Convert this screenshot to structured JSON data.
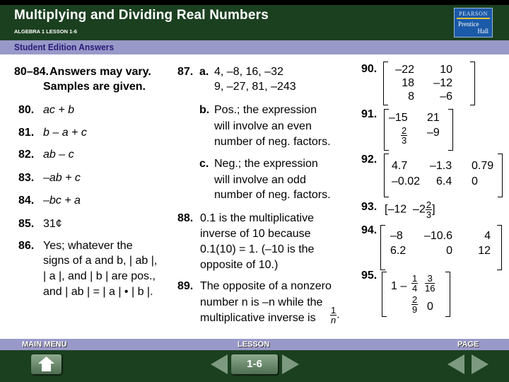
{
  "header": {
    "title": "Multiplying and Dividing Real Numbers",
    "subtitle": "ALGEBRA 1  LESSON 1-6",
    "logo_top": "PEARSON",
    "logo_line1": "Prentice",
    "logo_line2": "Hall"
  },
  "band": {
    "label": "Student Edition Answers"
  },
  "col1": {
    "intro_num": "80–84.",
    "intro_l1": "Answers may vary.",
    "intro_l2": "Samples are given.",
    "items": [
      {
        "num": "80.",
        "text": "ac + b"
      },
      {
        "num": "81.",
        "text": "b – a + c"
      },
      {
        "num": "82.",
        "text": "ab – c"
      },
      {
        "num": "83.",
        "text": "–ab + c"
      },
      {
        "num": "84.",
        "text": "–bc + a"
      },
      {
        "num": "85.",
        "text": "31¢"
      }
    ],
    "q86": {
      "num": "86.",
      "lines": [
        "Yes; whatever the",
        "signs of a and b, | ab |,",
        "| a |, and | b | are pos.,",
        "and | ab | = | a | • | b |."
      ]
    }
  },
  "col2": {
    "q87": {
      "num": "87.",
      "a_label": "a.",
      "a_lines": [
        "4, –8, 16, –32",
        "9, –27, 81, –243"
      ],
      "b_label": "b.",
      "b_lines": [
        "Pos.; the expression",
        " will involve an even",
        "number of neg. factors."
      ],
      "c_label": "c.",
      "c_lines": [
        "Neg.; the expression",
        "will involve an odd",
        "number of neg. factors."
      ]
    },
    "q88": {
      "num": "88.",
      "lines": [
        "0.1 is the multiplicative",
        "inverse of 10 because",
        "0.1(10) = 1. (–10 is the",
        "opposite of 10.)"
      ]
    },
    "q89": {
      "num": "89.",
      "lines": [
        "The opposite of a nonzero",
        "number n is –n while the",
        "multiplicative inverse is"
      ],
      "frac_num": "1",
      "frac_den": "n",
      "end": "."
    }
  },
  "col3": {
    "q90": {
      "num": "90.",
      "rows": [
        [
          "–22",
          "10"
        ],
        [
          "18",
          "–12"
        ],
        [
          "8",
          "–6"
        ]
      ]
    },
    "q91": {
      "num": "91.",
      "r1": [
        "–15",
        "21"
      ],
      "r2_frac_num": "2",
      "r2_frac_den": "3",
      "r2_c2": "–9"
    },
    "q92": {
      "num": "92.",
      "rows": [
        [
          "4.7",
          "–1.3",
          "0.79"
        ],
        [
          "–0.02",
          "6.4",
          "0"
        ]
      ]
    },
    "q93": {
      "num": "93.",
      "open": "[",
      "a": "–12",
      "b_whole": "–2",
      "b_num": "2",
      "b_den": "3",
      "close": "]"
    },
    "q94": {
      "num": "94.",
      "rows": [
        [
          "–8",
          "–10.6",
          "4"
        ],
        [
          "6.2",
          "0",
          "12"
        ]
      ]
    },
    "q95": {
      "num": "95.",
      "r1_a": "1 –",
      "r1_b_num": "1",
      "r1_b_den": "4",
      "r1_c_num": "3",
      "r1_c_den": "16",
      "r2_b_num": "2",
      "r2_b_den": "9",
      "r2_c": "0"
    }
  },
  "footer": {
    "main_menu": "MAIN MENU",
    "lesson": "LESSON",
    "lesson_value": "1-6",
    "page": "PAGE"
  }
}
